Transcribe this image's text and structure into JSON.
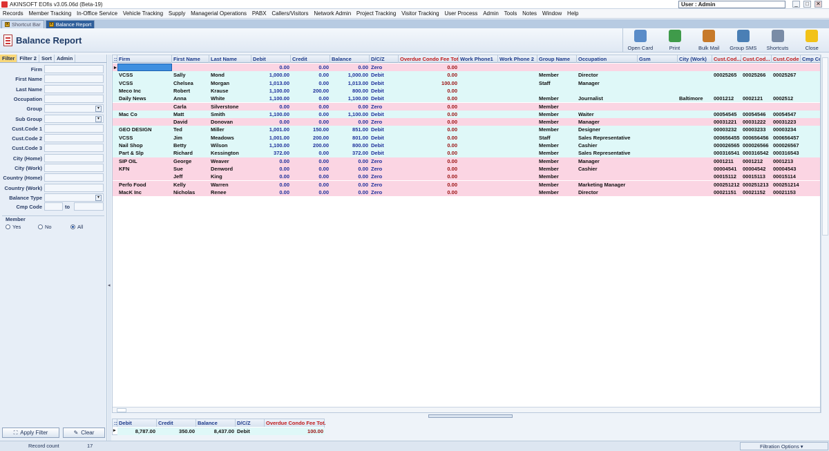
{
  "window": {
    "title": "AKINSOFT EOfis v3.05.06d (Beta-19)",
    "user": "User : Admin"
  },
  "menu": [
    "Records",
    "Member Tracking",
    "In-Office Service",
    "Vehicle Tracking",
    "Supply",
    "Managerial Operations",
    "PABX",
    "Callers/Visitors",
    "Network Admin",
    "Project Tracking",
    "Visitor Tracking",
    "User Process",
    "Admin",
    "Tools",
    "Notes",
    "Window",
    "Help"
  ],
  "tabs": [
    {
      "label": "Shortcut Bar",
      "active": false
    },
    {
      "label": "Balance Report",
      "active": true
    }
  ],
  "page": {
    "title": "Balance Report"
  },
  "toolbar": [
    {
      "label": "Open Card",
      "icon": "open-card-icon",
      "color": "#5a8cc8"
    },
    {
      "label": "Print",
      "icon": "print-icon",
      "color": "#3f9b4a"
    },
    {
      "label": "Bulk Mail",
      "icon": "bulk-mail-icon",
      "color": "#c77a2a"
    },
    {
      "label": "Group SMS",
      "icon": "group-sms-icon",
      "color": "#4a7fb5"
    },
    {
      "label": "Shortcuts",
      "icon": "shortcuts-icon",
      "color": "#7a8ca6"
    },
    {
      "label": "Close",
      "icon": "close-icon",
      "color": "#f2c218"
    }
  ],
  "filter_tabs": [
    "Filter",
    "Filter 2",
    "Sort",
    "Admin"
  ],
  "filters": [
    {
      "label": "Firm",
      "dropdown": false
    },
    {
      "label": "First Name",
      "dropdown": false
    },
    {
      "label": "Last Name",
      "dropdown": false
    },
    {
      "label": "Occupation",
      "dropdown": false
    },
    {
      "label": "Group",
      "dropdown": true
    },
    {
      "label": "Sub Group",
      "dropdown": true
    },
    {
      "label": "Cust.Code 1",
      "dropdown": false
    },
    {
      "label": "Cust.Code 2",
      "dropdown": false
    },
    {
      "label": "Cust.Code 3",
      "dropdown": false
    },
    {
      "label": "City (Home)",
      "dropdown": false
    },
    {
      "label": "City (Work)",
      "dropdown": false
    },
    {
      "label": "Country (Home)",
      "dropdown": false
    },
    {
      "label": "Country (Work)",
      "dropdown": false
    },
    {
      "label": "Balance Type",
      "dropdown": true
    }
  ],
  "cmp_code": {
    "label": "Cmp Code",
    "to": "to"
  },
  "member": {
    "label": "Member",
    "options": [
      "Yes",
      "No",
      "All"
    ],
    "selected": "All"
  },
  "buttons": {
    "apply": "Apply Filter",
    "clear": "Clear"
  },
  "status": {
    "record_count_label": "Record count",
    "record_count": "17",
    "filtration": "Filtration Options"
  },
  "grid": {
    "columns": [
      {
        "key": "firm",
        "label": "Firm"
      },
      {
        "key": "first",
        "label": "First Name"
      },
      {
        "key": "last",
        "label": "Last Name"
      },
      {
        "key": "debit",
        "label": "Debit"
      },
      {
        "key": "credit",
        "label": "Credit"
      },
      {
        "key": "balance",
        "label": "Balance"
      },
      {
        "key": "dcz",
        "label": "D/C/Z"
      },
      {
        "key": "overdue",
        "label": "Overdue Condo Fee Tot."
      },
      {
        "key": "wp1",
        "label": "Work Phone1"
      },
      {
        "key": "wp2",
        "label": "Work Phone 2"
      },
      {
        "key": "group",
        "label": "Group Name"
      },
      {
        "key": "occupation",
        "label": "Occupation"
      },
      {
        "key": "gsm",
        "label": "Gsm"
      },
      {
        "key": "citywork",
        "label": "City (Work)"
      },
      {
        "key": "cc1",
        "label": "Cust.Cod..."
      },
      {
        "key": "cc2",
        "label": "Cust.Cod..."
      },
      {
        "key": "cc3",
        "label": "Cust.Code 3"
      },
      {
        "key": "cmp",
        "label": "Cmp Co"
      }
    ],
    "rows": [
      {
        "firm": "",
        "first": "",
        "last": "",
        "debit": "0.00",
        "credit": "0.00",
        "balance": "0.00",
        "dcz": "Zero",
        "overdue": "0.00",
        "group": "",
        "occupation": "",
        "citywork": "",
        "cc1": "",
        "cc2": "",
        "cc3": ""
      },
      {
        "firm": "VCSS",
        "first": "Sally",
        "last": "Mond",
        "debit": "1,000.00",
        "credit": "0.00",
        "balance": "1,000.00",
        "dcz": "Debit",
        "overdue": "0.00",
        "group": "Member",
        "occupation": "Director",
        "citywork": "",
        "cc1": "00025265",
        "cc2": "00025266",
        "cc3": "00025267"
      },
      {
        "firm": "VCSS",
        "first": "Chelsea",
        "last": "Morgan",
        "debit": "1,013.00",
        "credit": "0.00",
        "balance": "1,013.00",
        "dcz": "Debit",
        "overdue": "100.00",
        "group": "Staff",
        "occupation": "Manager",
        "citywork": "",
        "cc1": "",
        "cc2": "",
        "cc3": ""
      },
      {
        "firm": "Meco Inc",
        "first": "Robert",
        "last": "Krause",
        "debit": "1,100.00",
        "credit": "200.00",
        "balance": "800.00",
        "dcz": "Debit",
        "overdue": "0.00",
        "group": "",
        "occupation": "",
        "citywork": "",
        "cc1": "",
        "cc2": "",
        "cc3": ""
      },
      {
        "firm": "Daily News",
        "first": "Anna",
        "last": "White",
        "debit": "1,100.00",
        "credit": "0.00",
        "balance": "1,100.00",
        "dcz": "Debit",
        "overdue": "0.00",
        "group": "Member",
        "occupation": "Journalist",
        "citywork": "Baltimore",
        "cc1": "0001212",
        "cc2": "0002121",
        "cc3": "0002512"
      },
      {
        "firm": "",
        "first": "Carla",
        "last": "Silverstone",
        "debit": "0.00",
        "credit": "0.00",
        "balance": "0.00",
        "dcz": "Zero",
        "overdue": "0.00",
        "group": "Member",
        "occupation": "",
        "citywork": "",
        "cc1": "",
        "cc2": "",
        "cc3": ""
      },
      {
        "firm": "Mac Co",
        "first": "Matt",
        "last": "Smith",
        "debit": "1,100.00",
        "credit": "0.00",
        "balance": "1,100.00",
        "dcz": "Debit",
        "overdue": "0.00",
        "group": "Member",
        "occupation": "Waiter",
        "citywork": "",
        "cc1": "00054545",
        "cc2": "00054546",
        "cc3": "00054547"
      },
      {
        "firm": "",
        "first": "David",
        "last": "Donovan",
        "debit": "0.00",
        "credit": "0.00",
        "balance": "0.00",
        "dcz": "Zero",
        "overdue": "0.00",
        "group": "Member",
        "occupation": "Manager",
        "citywork": "",
        "cc1": "00031221",
        "cc2": "00031222",
        "cc3": "00031223"
      },
      {
        "firm": "GEO DESIGN",
        "first": "Ted",
        "last": "Miller",
        "debit": "1,001.00",
        "credit": "150.00",
        "balance": "851.00",
        "dcz": "Debit",
        "overdue": "0.00",
        "group": "Member",
        "occupation": "Designer",
        "citywork": "",
        "cc1": "00003232",
        "cc2": "00003233",
        "cc3": "00003234"
      },
      {
        "firm": "VCSS",
        "first": "Jim",
        "last": "Meadows",
        "debit": "1,001.00",
        "credit": "200.00",
        "balance": "801.00",
        "dcz": "Debit",
        "overdue": "0.00",
        "group": "Staff",
        "occupation": "Sales Representative",
        "citywork": "",
        "cc1": "000656455",
        "cc2": "000656456",
        "cc3": "000656457"
      },
      {
        "firm": "Nail Shop",
        "first": "Betty",
        "last": "Wilson",
        "debit": "1,100.00",
        "credit": "200.00",
        "balance": "800.00",
        "dcz": "Debit",
        "overdue": "0.00",
        "group": "Member",
        "occupation": "Cashier",
        "citywork": "",
        "cc1": "000026565",
        "cc2": "000026566",
        "cc3": "000026567"
      },
      {
        "firm": "Part & Slp",
        "first": "Richard",
        "last": "Kessington",
        "debit": "372.00",
        "credit": "0.00",
        "balance": "372.00",
        "dcz": "Debit",
        "overdue": "0.00",
        "group": "Member",
        "occupation": "Sales Representative",
        "citywork": "",
        "cc1": "000316541",
        "cc2": "000316542",
        "cc3": "000316543"
      },
      {
        "firm": "SIP OIL",
        "first": "George",
        "last": "Weaver",
        "debit": "0.00",
        "credit": "0.00",
        "balance": "0.00",
        "dcz": "Zero",
        "overdue": "0.00",
        "group": "Member",
        "occupation": "Manager",
        "citywork": "",
        "cc1": "0001211",
        "cc2": "0001212",
        "cc3": "0001213"
      },
      {
        "firm": "KFN",
        "first": "Sue",
        "last": "Denword",
        "debit": "0.00",
        "credit": "0.00",
        "balance": "0.00",
        "dcz": "Zero",
        "overdue": "0.00",
        "group": "Member",
        "occupation": "Cashier",
        "citywork": "",
        "cc1": "00004541",
        "cc2": "00004542",
        "cc3": "00004543"
      },
      {
        "firm": "",
        "first": "Jeff",
        "last": "King",
        "debit": "0.00",
        "credit": "0.00",
        "balance": "0.00",
        "dcz": "Zero",
        "overdue": "0.00",
        "group": "Member",
        "occupation": "",
        "citywork": "",
        "cc1": "00015112",
        "cc2": "00015113",
        "cc3": "00015114"
      },
      {
        "firm": "Perfo Food",
        "first": "Kelly",
        "last": "Warren",
        "debit": "0.00",
        "credit": "0.00",
        "balance": "0.00",
        "dcz": "Zero",
        "overdue": "0.00",
        "group": "Member",
        "occupation": "Marketing Manager",
        "citywork": "",
        "cc1": "000251212",
        "cc2": "000251213",
        "cc3": "000251214"
      },
      {
        "firm": "MacK Inc",
        "first": "Nicholas",
        "last": "Renee",
        "debit": "0.00",
        "credit": "0.00",
        "balance": "0.00",
        "dcz": "Zero",
        "overdue": "0.00",
        "group": "Member",
        "occupation": "Director",
        "citywork": "",
        "cc1": "00021151",
        "cc2": "00021152",
        "cc3": "00021153"
      }
    ]
  },
  "totals": {
    "columns": [
      "Debit",
      "Credit",
      "Balance",
      "D/C/Z",
      "Overdue Condo Fee Tot."
    ],
    "values": [
      "8,787.00",
      "350.00",
      "8,437.00",
      "Debit",
      "100.00"
    ]
  }
}
